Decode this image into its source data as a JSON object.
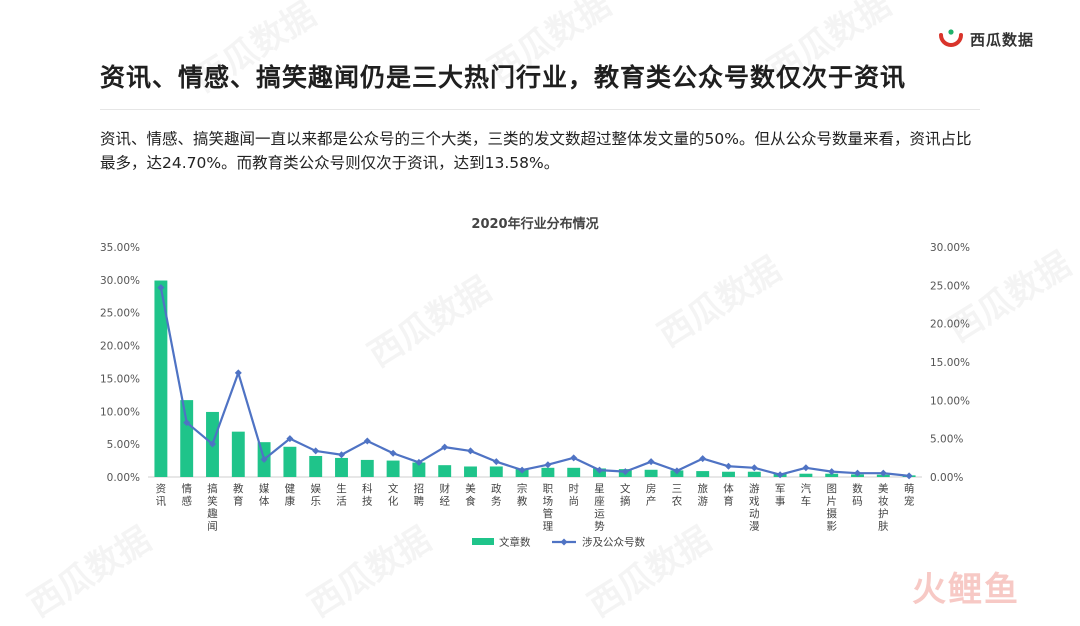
{
  "brand": {
    "name": "西瓜数据",
    "accent": "#d9342b"
  },
  "watermark_text": "西瓜数据",
  "corner_mark": "火鲤鱼",
  "title": "资讯、情感、搞笑趣闻仍是三大热门行业，教育类公众号数仅次于资讯",
  "description": "资讯、情感、搞笑趣闻一直以来都是公众号的三个大类，三类的发文数超过整体发文量的50%。但从公众号数量来看，资讯占比最多，达24.70%。而教育类公众号则仅次于资讯，达到13.58%。",
  "chart_data": {
    "type": "bar",
    "title": "2020年行业分布情况",
    "categories": [
      "资讯",
      "情感",
      "搞笑趣闻",
      "教育",
      "媒体",
      "健康",
      "娱乐",
      "生活",
      "科技",
      "文化",
      "招聘",
      "财经",
      "美食",
      "政务",
      "宗教",
      "职场管理",
      "时尚",
      "星座运势",
      "文摘",
      "房产",
      "三农",
      "旅游",
      "体育",
      "游戏动漫",
      "军事",
      "汽车",
      "图片摄影",
      "数码",
      "美妆护肤",
      "萌宠"
    ],
    "series": [
      {
        "name": "文章数",
        "type": "bar",
        "axis": "left",
        "color": "#1fc48a",
        "values": [
          29.9,
          11.7,
          9.9,
          6.9,
          5.3,
          4.6,
          3.2,
          2.9,
          2.6,
          2.5,
          2.2,
          1.8,
          1.6,
          1.6,
          1.3,
          1.4,
          1.4,
          1.3,
          1.2,
          1.1,
          1.0,
          0.9,
          0.8,
          0.8,
          0.6,
          0.5,
          0.5,
          0.4,
          0.35,
          0.25
        ]
      },
      {
        "name": "涉及公众号数",
        "type": "line",
        "axis": "right",
        "color": "#4f73c4",
        "values": [
          24.7,
          7.1,
          4.3,
          13.58,
          2.3,
          5.0,
          3.4,
          2.9,
          4.7,
          3.1,
          1.9,
          3.9,
          3.4,
          2.0,
          0.9,
          1.6,
          2.5,
          0.9,
          0.7,
          2.0,
          0.8,
          2.4,
          1.4,
          1.2,
          0.3,
          1.2,
          0.7,
          0.5,
          0.5,
          0.15
        ]
      }
    ],
    "left_axis": {
      "min": 0,
      "max": 35,
      "step": 5,
      "tick_labels": [
        "0.00%",
        "5.00%",
        "10.00%",
        "15.00%",
        "20.00%",
        "25.00%",
        "30.00%",
        "35.00%"
      ]
    },
    "right_axis": {
      "min": 0,
      "max": 30,
      "step": 5,
      "tick_labels": [
        "0.00%",
        "5.00%",
        "10.00%",
        "15.00%",
        "20.00%",
        "25.00%",
        "30.00%"
      ]
    },
    "grid": false,
    "legend_position": "bottom"
  }
}
